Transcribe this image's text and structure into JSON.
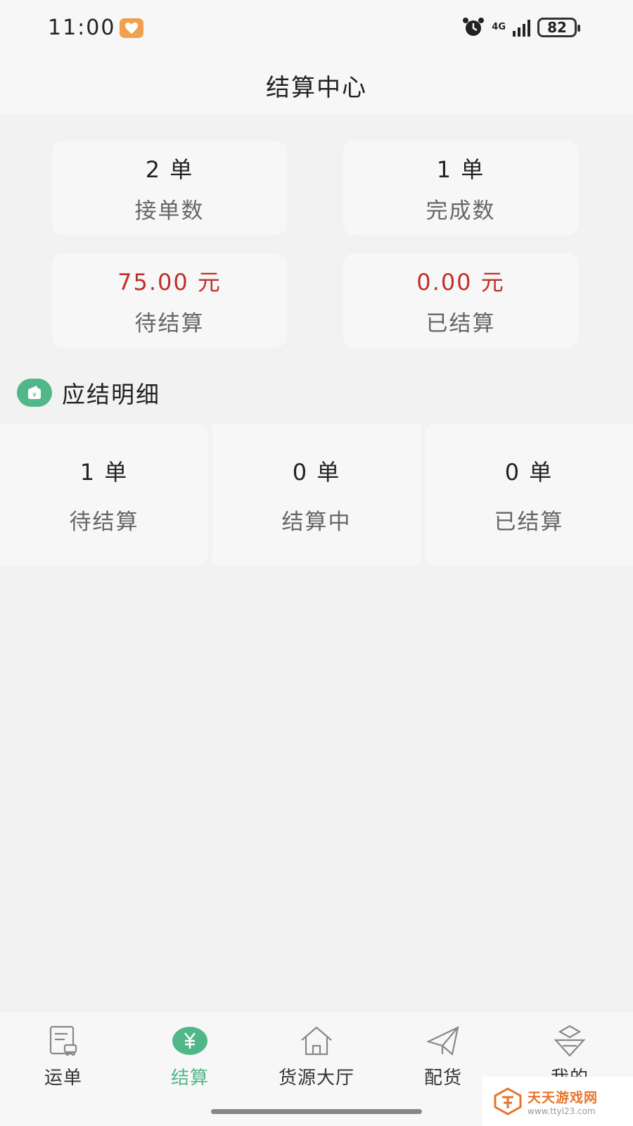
{
  "statusbar": {
    "time": "11:00",
    "network": "4G",
    "battery": "82"
  },
  "header": {
    "title": "结算中心"
  },
  "stats": [
    {
      "value": "2 单",
      "label": "接单数"
    },
    {
      "value": "1 单",
      "label": "完成数"
    },
    {
      "value": "75.00 元",
      "label": "待结算"
    },
    {
      "value": "0.00 元",
      "label": "已结算"
    }
  ],
  "section": {
    "title": "应结明细"
  },
  "details": [
    {
      "value": "1 单",
      "label": "待结算"
    },
    {
      "value": "0 单",
      "label": "结算中"
    },
    {
      "value": "0 单",
      "label": "已结算"
    }
  ],
  "tabs": [
    {
      "label": "运单",
      "icon": "waybill-icon"
    },
    {
      "label": "结算",
      "icon": "yen-icon",
      "active": true
    },
    {
      "label": "货源大厅",
      "icon": "home-icon"
    },
    {
      "label": "配货",
      "icon": "send-icon"
    },
    {
      "label": "我的",
      "icon": "profile-icon"
    }
  ],
  "watermark": {
    "name": "天天游戏网",
    "url": "www.ttyl23.com"
  },
  "colors": {
    "accent": "#52b788",
    "amount_red": "#c0302a"
  }
}
